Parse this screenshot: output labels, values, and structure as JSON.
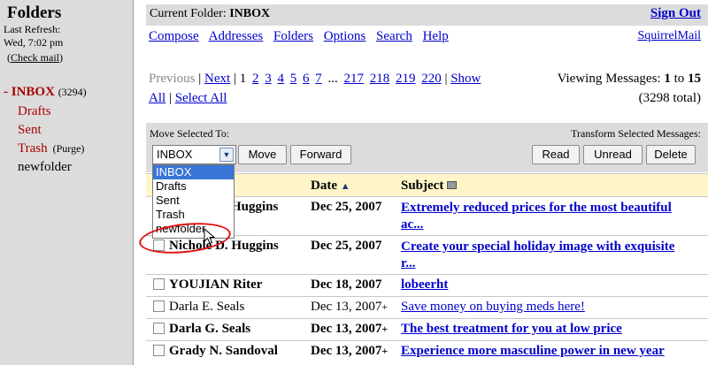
{
  "left": {
    "title": "Folders",
    "last_refresh_label": "Last Refresh:",
    "last_refresh_time": "Wed, 7:02 pm",
    "check_mail": "Check mail",
    "folders": [
      {
        "prefix": "- ",
        "label": "INBOX",
        "count": "(3294)"
      },
      {
        "label": "Drafts"
      },
      {
        "label": "Sent"
      },
      {
        "label": "Trash",
        "extra": "(Purge)"
      },
      {
        "label": "newfolder"
      }
    ]
  },
  "top": {
    "current_folder_label": "Current Folder:",
    "current_folder": "INBOX",
    "sign_out": "Sign Out",
    "nav": [
      "Compose",
      "Addresses",
      "Folders",
      "Options",
      "Search",
      "Help"
    ],
    "brand": "SquirrelMail"
  },
  "pager": {
    "previous": "Previous",
    "next": "Next",
    "current": "1",
    "pages_a": [
      "2",
      "3",
      "4",
      "5",
      "6",
      "7"
    ],
    "ellipsis": "...",
    "pages_b": [
      "217",
      "218",
      "219",
      "220"
    ],
    "show": "Show",
    "all": "All",
    "select_all": "Select All",
    "viewing_label": "Viewing Messages:",
    "from": "1",
    "to_word": "to",
    "to": "15",
    "total": "(3298 total)"
  },
  "actions": {
    "move_label": "Move Selected To:",
    "selected_folder": "INBOX",
    "move": "Move",
    "forward": "Forward",
    "transform_label": "Transform Selected Messages:",
    "read": "Read",
    "unread": "Unread",
    "delete": "Delete"
  },
  "dropdown": {
    "options": [
      "INBOX",
      "Drafts",
      "Sent",
      "Trash",
      "newfolder"
    ],
    "highlighted": "INBOX"
  },
  "table": {
    "headers": {
      "date": "Date",
      "subject": "Subject"
    },
    "rows": [
      {
        "from": "Huggins",
        "date": "Dec 25, 2007",
        "plus": "",
        "subject": "Extremely reduced prices for the most beautiful",
        "subject2": "ac...",
        "unread": true
      },
      {
        "from": "Nichole D. Huggins",
        "date": "Dec 25, 2007",
        "plus": "",
        "subject": "Create your special holiday image with exquisite",
        "subject2": "r...",
        "unread": true
      },
      {
        "from": "YOUJIAN Riter",
        "date": "Dec 18, 2007",
        "plus": "",
        "subject": "lobeerht",
        "subject2": "",
        "unread": true
      },
      {
        "from": "Darla E. Seals",
        "date": "Dec 13, 2007",
        "plus": "+",
        "subject": "Save money on buying meds here!",
        "subject2": "",
        "unread": false
      },
      {
        "from": "Darla G. Seals",
        "date": "Dec 13, 2007",
        "plus": "+",
        "subject": "The best treatment for you at low price",
        "subject2": "",
        "unread": true
      },
      {
        "from": "Grady N. Sandoval",
        "date": "Dec 13, 2007",
        "plus": "+",
        "subject": "Experience more masculine power in new year",
        "subject2": "",
        "unread": true
      }
    ]
  },
  "colors": {
    "pane_gray": "#dcdcdc",
    "header_yellow": "#fff5c8",
    "link_blue": "#0000cc",
    "folder_red": "#aa0000",
    "annotation_red": "#e01010",
    "select_highlight": "#3875d7"
  }
}
